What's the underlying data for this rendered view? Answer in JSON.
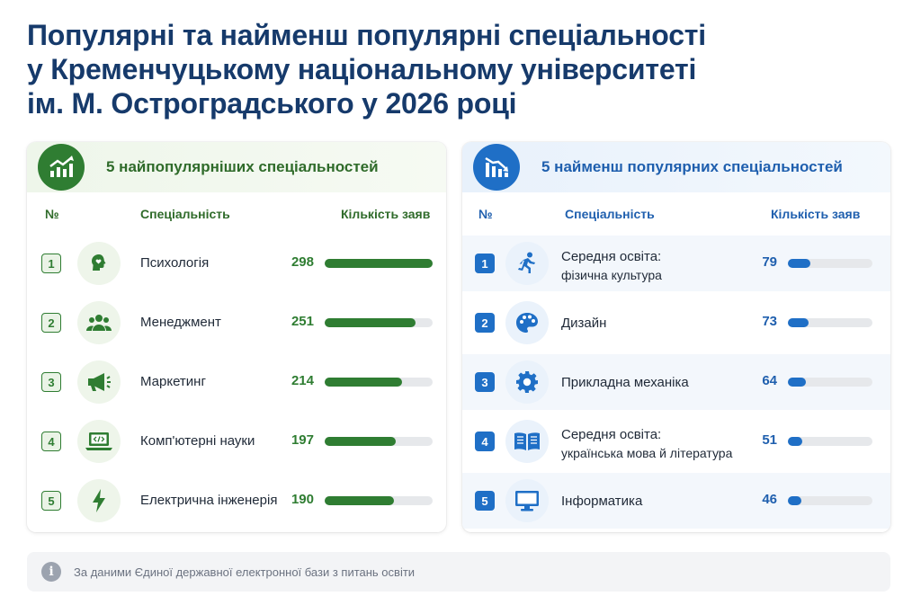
{
  "title_lines": [
    "Популярні та найменш популярні спеціальності",
    "у Кременчуцькому національному університеті",
    "ім. М. Остроградського у 2026 році"
  ],
  "colors": {
    "green": "#2f7d32",
    "blue": "#1f6fc6",
    "title": "#163a6b"
  },
  "columns": {
    "num": "№",
    "specialty": "Спеціальність",
    "count": "Кількість заяв"
  },
  "chart_data": [
    {
      "type": "bar",
      "title": "5 найпопулярніших спеціальностей",
      "xlabel": "Спеціальність",
      "ylabel": "Кількість заяв",
      "ylim": [
        0,
        298
      ],
      "categories": [
        "Психологія",
        "Менеджмент",
        "Маркетинг",
        "Комп'ютерні науки",
        "Електрична інженерія"
      ],
      "values": [
        298,
        251,
        214,
        197,
        190
      ],
      "ranks": [
        "1",
        "2",
        "3",
        "4",
        "5"
      ],
      "icons": [
        "head-heart-icon",
        "people-group-icon",
        "megaphone-icon",
        "laptop-code-icon",
        "lightning-icon"
      ]
    },
    {
      "type": "bar",
      "title": "5 найменш популярних спеціальностей",
      "xlabel": "Спеціальність",
      "ylabel": "Кількість заяв",
      "ylim": [
        0,
        298
      ],
      "categories": [
        [
          "Середня освіта:",
          "фізична культура"
        ],
        [
          "Дизайн"
        ],
        [
          "Прикладна механіка"
        ],
        [
          "Середня освіта:",
          "українська мова й література"
        ],
        [
          "Інформатика"
        ]
      ],
      "values": [
        79,
        73,
        64,
        51,
        46
      ],
      "ranks": [
        "1",
        "2",
        "3",
        "4",
        "5"
      ],
      "icons": [
        "running-person-icon",
        "palette-icon",
        "gear-icon",
        "open-book-icon",
        "monitor-icon"
      ]
    }
  ],
  "footer": {
    "text": "За даними Єдиної державної електронної бази з питань освіти",
    "icon": "info-icon"
  }
}
